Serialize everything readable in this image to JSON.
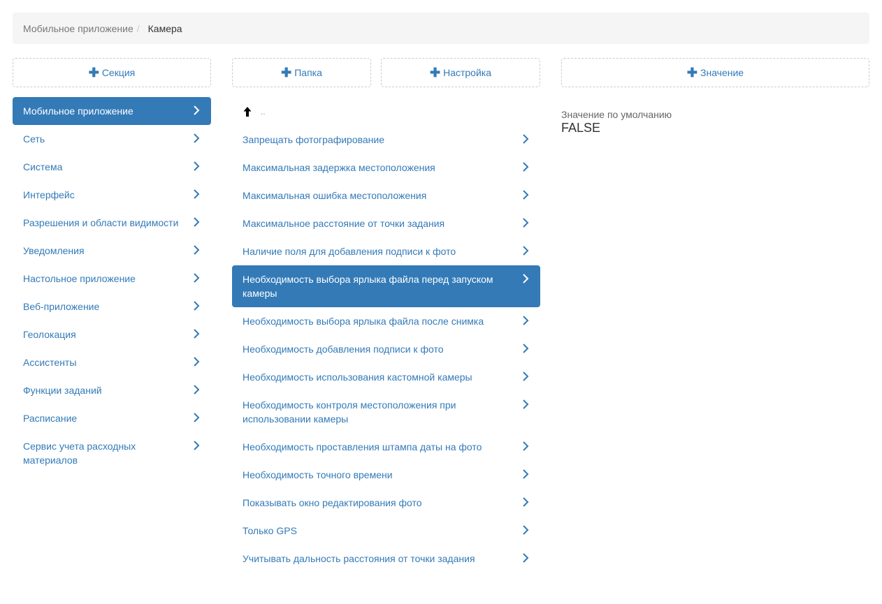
{
  "breadcrumb": {
    "parent": "Мобильное приложение",
    "separator": "/",
    "current": "Камера"
  },
  "buttons": {
    "add_section": "Секция",
    "add_folder": "Папка",
    "add_setting": "Настройка",
    "add_value": "Значение"
  },
  "sections": {
    "items": [
      {
        "label": "Мобильное приложение",
        "active": true
      },
      {
        "label": "Сеть"
      },
      {
        "label": "Система"
      },
      {
        "label": "Интерфейс"
      },
      {
        "label": "Разрешения и области видимости"
      },
      {
        "label": "Уведомления"
      },
      {
        "label": "Настольное приложение"
      },
      {
        "label": "Веб-приложение"
      },
      {
        "label": "Геолокация"
      },
      {
        "label": "Ассистенты"
      },
      {
        "label": "Функции заданий"
      },
      {
        "label": "Расписание"
      },
      {
        "label": "Сервис учета расходных материалов"
      }
    ]
  },
  "settings": {
    "up_label": "..",
    "items": [
      {
        "label": "Запрещать фотографирование"
      },
      {
        "label": "Максимальная задержка местоположения"
      },
      {
        "label": "Максимальная ошибка местоположения"
      },
      {
        "label": "Максимальное расстояние от точки задания"
      },
      {
        "label": "Наличие поля для добавления подписи к фото"
      },
      {
        "label": "Необходимость выбора ярлыка файла перед запуском камеры",
        "active": true
      },
      {
        "label": "Необходимость выбора ярлыка файла после снимка"
      },
      {
        "label": "Необходимость добавления подписи к фото"
      },
      {
        "label": "Необходимость использования кастомной камеры"
      },
      {
        "label": "Необходимость контроля местоположения при использовании камеры"
      },
      {
        "label": "Необходимость проставления штампа даты на фото"
      },
      {
        "label": "Необходимость точного времени"
      },
      {
        "label": "Показывать окно редактирования фото"
      },
      {
        "label": "Только GPS"
      },
      {
        "label": "Учитывать дальность расстояния от точки задания"
      }
    ]
  },
  "value_panel": {
    "label": "Значение по умолчанию",
    "value": "FALSE"
  },
  "colors": {
    "accent": "#337ab7",
    "breadcrumb_bg": "#f5f5f5"
  }
}
